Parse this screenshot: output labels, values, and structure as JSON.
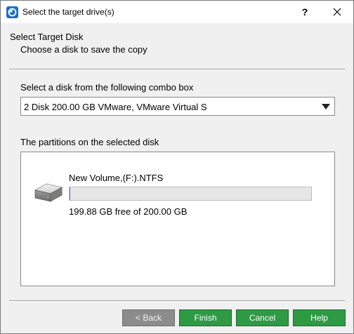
{
  "window": {
    "title": "Select the target drive(s)",
    "help_glyph": "?",
    "close_glyph": "✕"
  },
  "header": {
    "title": "Select Target Disk",
    "subtitle": "Choose a disk to save the copy"
  },
  "combo": {
    "label": "Select a disk from the following combo box",
    "selected": "2 Disk 200.00 GB VMware,  VMware Virtual S"
  },
  "partitions": {
    "label": "The partitions on the selected disk",
    "items": [
      {
        "name": "New Volume,(F:).NTFS",
        "free_text": "199.88 GB free of 200.00 GB",
        "used_fraction": 0.0006
      }
    ]
  },
  "buttons": {
    "back": "< Back",
    "finish": "Finish",
    "cancel": "Cancel",
    "help": "Help"
  },
  "colors": {
    "accent_green": "#2e9a44",
    "disabled_gray": "#8c8c8c"
  }
}
